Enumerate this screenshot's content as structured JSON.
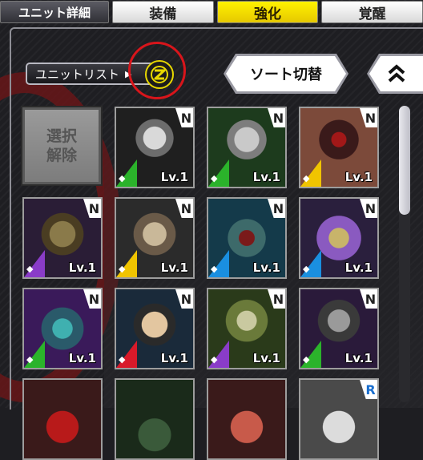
{
  "tabs": [
    {
      "label": "ユニット詳細",
      "state": "normal"
    },
    {
      "label": "装備",
      "state": "normal"
    },
    {
      "label": "強化",
      "state": "active"
    },
    {
      "label": "覚醒",
      "state": "normal"
    }
  ],
  "controls": {
    "unit_list_label": "ユニットリスト",
    "sort_label": "ソート切替",
    "badge_icon": "z-logo-icon",
    "collapse_icon": "double-chevron-up-icon"
  },
  "deselect": {
    "label_line1": "選択",
    "label_line2": "解除"
  },
  "units": [
    {
      "name": "unit-1",
      "rarity": "N",
      "level": "Lv.1",
      "attribute": "green",
      "icon": "ninja-helmet-portrait"
    },
    {
      "name": "unit-2",
      "rarity": "N",
      "level": "Lv.1",
      "attribute": "green",
      "icon": "silver-helmet-portrait"
    },
    {
      "name": "unit-3",
      "rarity": "N",
      "level": "Lv.1",
      "attribute": "yellow",
      "icon": "masked-soldier-portrait"
    },
    {
      "name": "unit-4",
      "rarity": "N",
      "level": "Lv.1",
      "attribute": "purple",
      "icon": "armored-robot-portrait"
    },
    {
      "name": "unit-5",
      "rarity": "N",
      "level": "Lv.1",
      "attribute": "yellow",
      "icon": "wild-hair-demon-portrait"
    },
    {
      "name": "unit-6",
      "rarity": "N",
      "level": "Lv.1",
      "attribute": "blue",
      "icon": "fanged-creature-portrait"
    },
    {
      "name": "unit-7",
      "rarity": "N",
      "level": "Lv.1",
      "attribute": "blue",
      "icon": "hooded-youth-portrait"
    },
    {
      "name": "unit-8",
      "rarity": "N",
      "level": "Lv.1",
      "attribute": "green",
      "icon": "cyber-dragon-portrait"
    },
    {
      "name": "unit-9",
      "rarity": "N",
      "level": "Lv.1",
      "attribute": "red",
      "icon": "noble-man-portrait"
    },
    {
      "name": "unit-10",
      "rarity": "N",
      "level": "Lv.1",
      "attribute": "purple",
      "icon": "goggles-soldier-portrait"
    },
    {
      "name": "unit-11",
      "rarity": "N",
      "level": "Lv.1",
      "attribute": "green",
      "icon": "insect-mask-portrait"
    },
    {
      "name": "unit-12",
      "rarity": "",
      "level": "",
      "attribute": "",
      "icon": "red-helmet-portrait"
    },
    {
      "name": "unit-13",
      "rarity": "",
      "level": "",
      "attribute": "",
      "icon": "spiky-hair-portrait"
    },
    {
      "name": "unit-14",
      "rarity": "",
      "level": "",
      "attribute": "",
      "icon": "red-beast-portrait"
    },
    {
      "name": "unit-15",
      "rarity": "R",
      "level": "",
      "attribute": "",
      "icon": "silver-hair-portrait"
    }
  ],
  "colors": {
    "tab_active": "#fff200",
    "highlight_circle": "#d8151b",
    "attr_green": "#2bb32b",
    "attr_yellow": "#f0c400",
    "attr_purple": "#8a3cc8",
    "attr_blue": "#1a8fe0",
    "attr_red": "#d81a2a"
  }
}
